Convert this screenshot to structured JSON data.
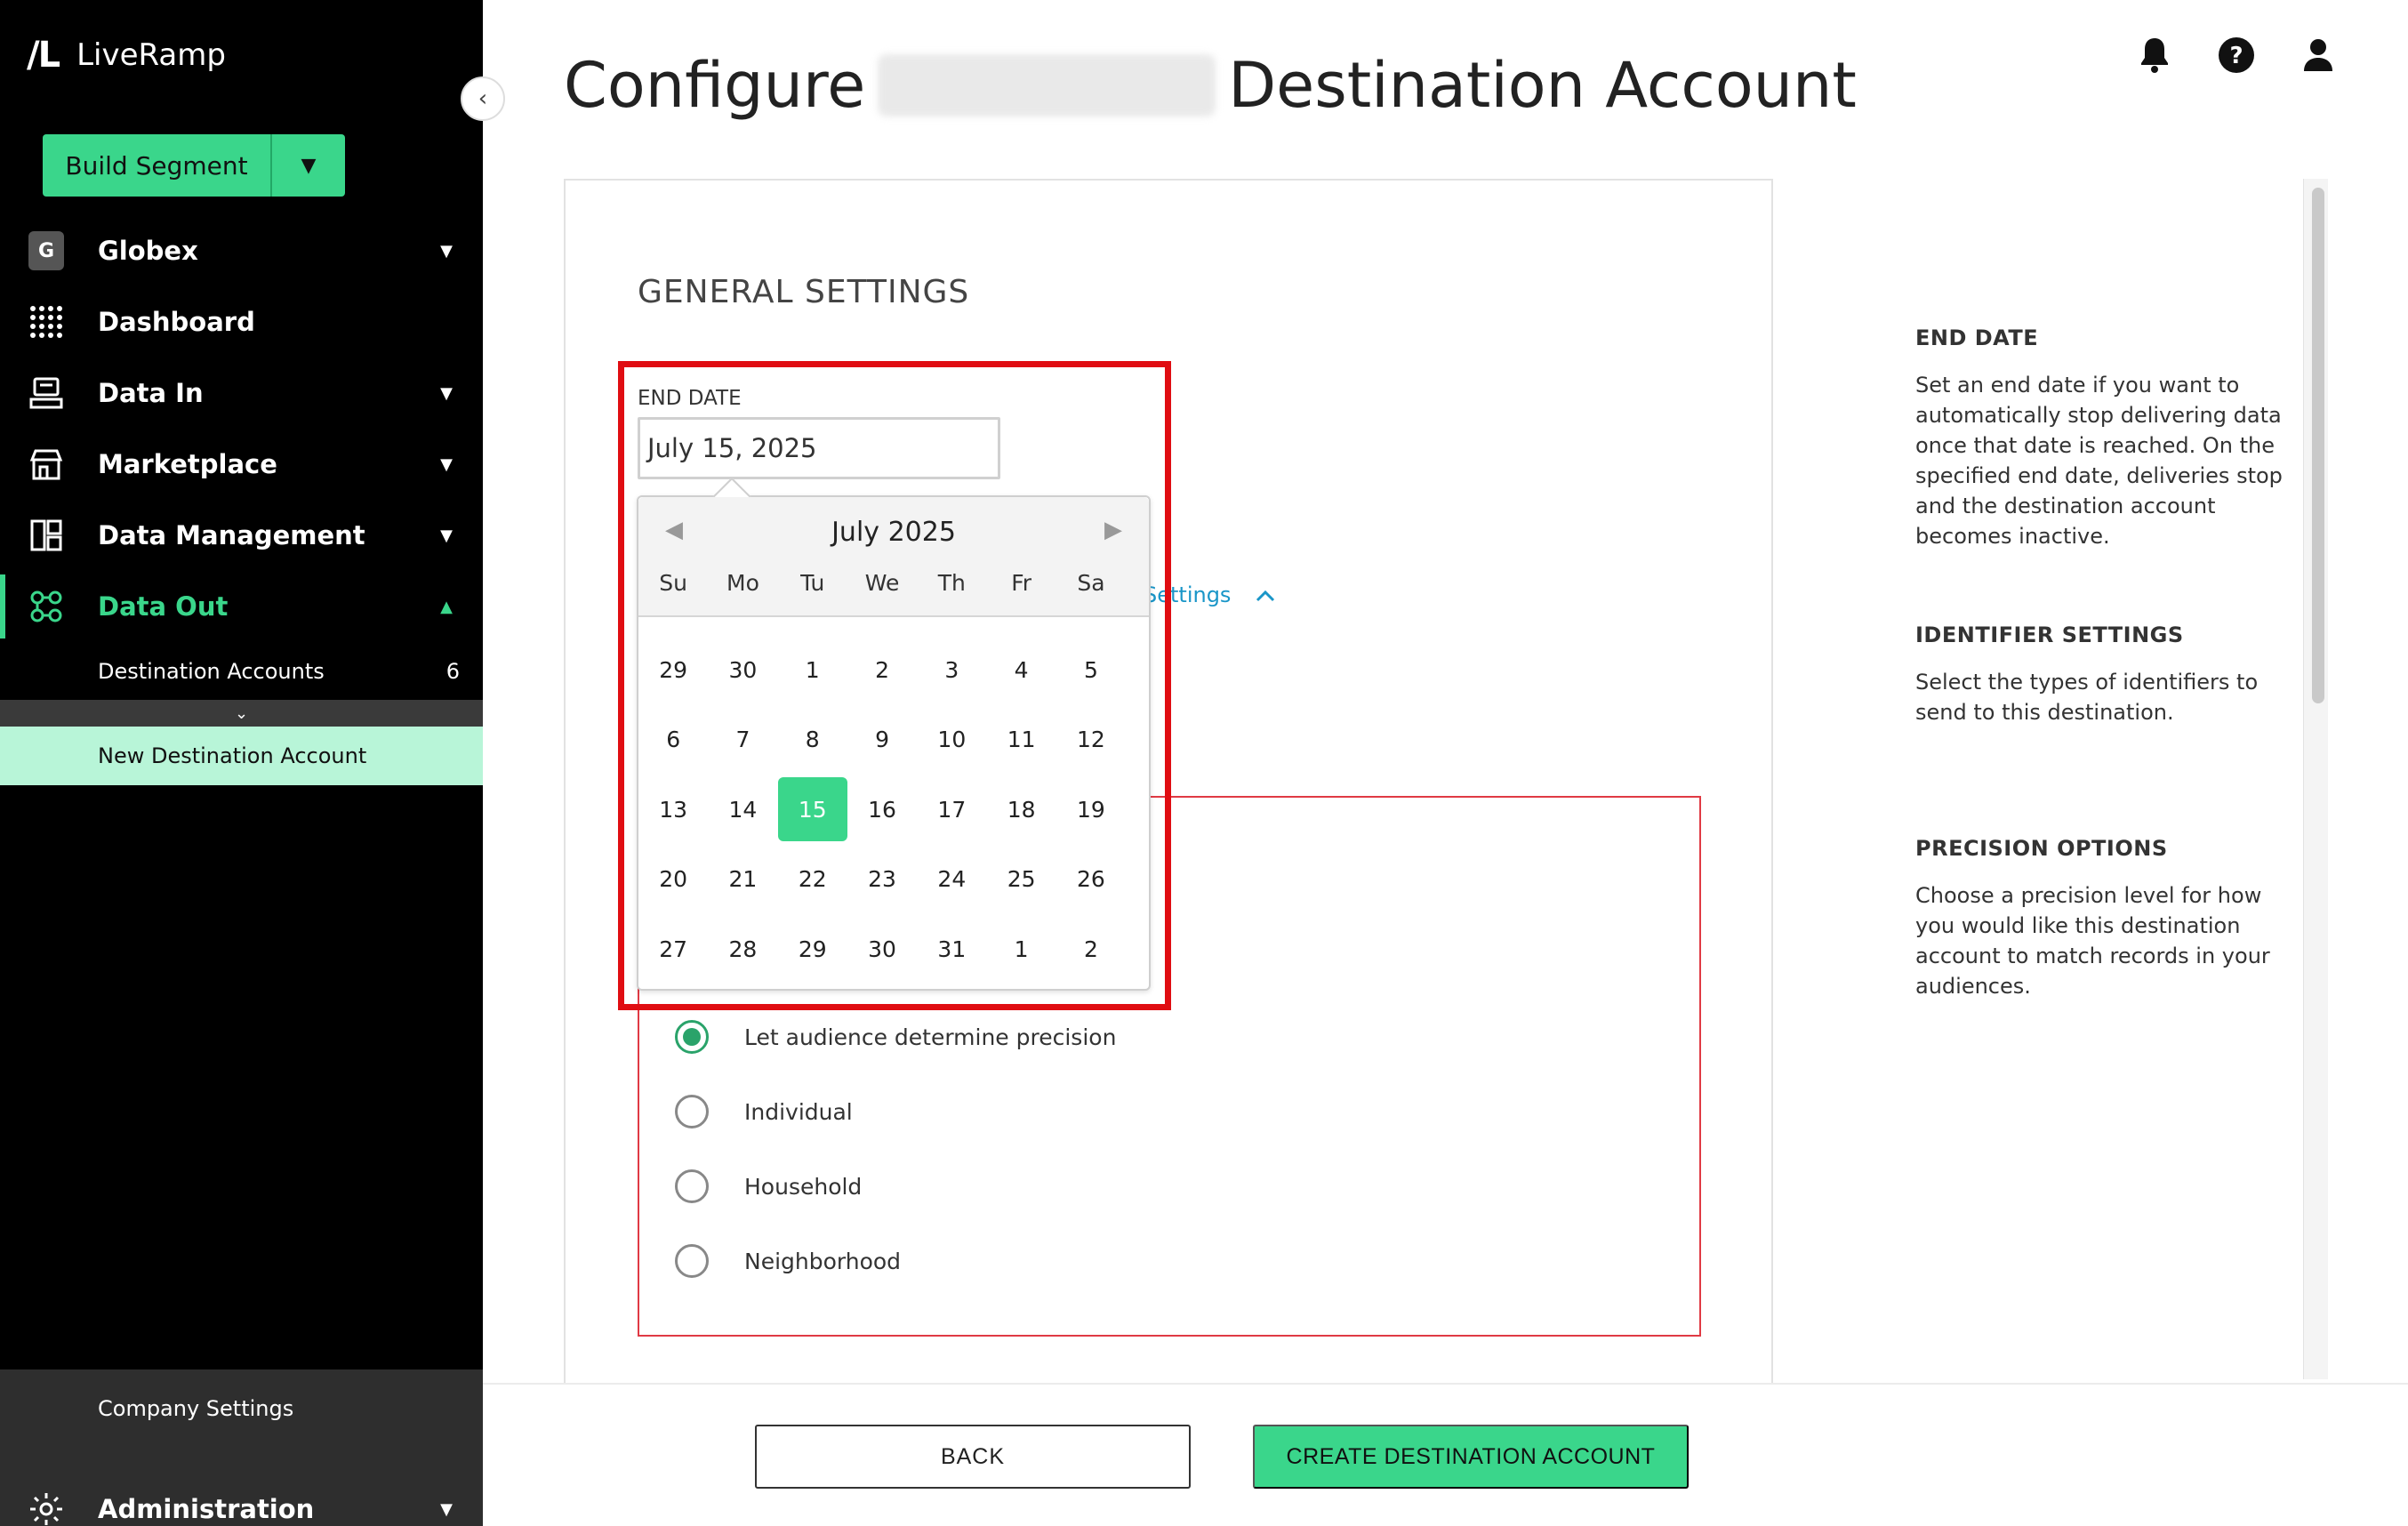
{
  "brand": {
    "mark": "/L",
    "name": "LiveRamp"
  },
  "sidebar": {
    "build_segment": "Build Segment",
    "org": {
      "badge": "G",
      "label": "Globex"
    },
    "items": [
      {
        "label": "Dashboard"
      },
      {
        "label": "Data In"
      },
      {
        "label": "Marketplace"
      },
      {
        "label": "Data Management"
      },
      {
        "label": "Data Out"
      }
    ],
    "sub_items": [
      {
        "label": "Destination Accounts",
        "count": "6"
      },
      {
        "label": "New Destination Account"
      }
    ],
    "company_settings": "Company Settings",
    "administration": "Administration"
  },
  "header": {
    "title_prefix": "Configure",
    "title_suffix": "Destination Account"
  },
  "form": {
    "section_title": "GENERAL SETTINGS",
    "end_date_label": "END DATE",
    "end_date_value": "July 15, 2025",
    "identifier_link": "Settings",
    "precision_options": [
      {
        "label": "Let audience determine precision",
        "selected": true
      },
      {
        "label": "Individual",
        "selected": false
      },
      {
        "label": "Household",
        "selected": false
      },
      {
        "label": "Neighborhood",
        "selected": false
      }
    ]
  },
  "calendar": {
    "month_label": "July 2025",
    "weekdays": [
      "Su",
      "Mo",
      "Tu",
      "We",
      "Th",
      "Fr",
      "Sa"
    ],
    "weeks": [
      [
        "29",
        "30",
        "1",
        "2",
        "3",
        "4",
        "5"
      ],
      [
        "6",
        "7",
        "8",
        "9",
        "10",
        "11",
        "12"
      ],
      [
        "13",
        "14",
        "15",
        "16",
        "17",
        "18",
        "19"
      ],
      [
        "20",
        "21",
        "22",
        "23",
        "24",
        "25",
        "26"
      ],
      [
        "27",
        "28",
        "29",
        "30",
        "31",
        "1",
        "2"
      ]
    ],
    "selected_day": "15"
  },
  "help": [
    {
      "title": "END DATE",
      "text": "Set an end date if you want to automatically stop delivering data once that date is reached. On the specified end date, deliveries stop and the destination account becomes inactive."
    },
    {
      "title": "IDENTIFIER SETTINGS",
      "text": "Select the types of identifiers to send to this destination."
    },
    {
      "title": "PRECISION OPTIONS",
      "text": "Choose a precision level for how you would like this destination account to match records in your audiences."
    }
  ],
  "footer": {
    "back": "BACK",
    "create": "CREATE DESTINATION ACCOUNT"
  },
  "colors": {
    "accent": "#3ad68b",
    "highlight": "#e00d12",
    "link": "#1a96c8"
  }
}
